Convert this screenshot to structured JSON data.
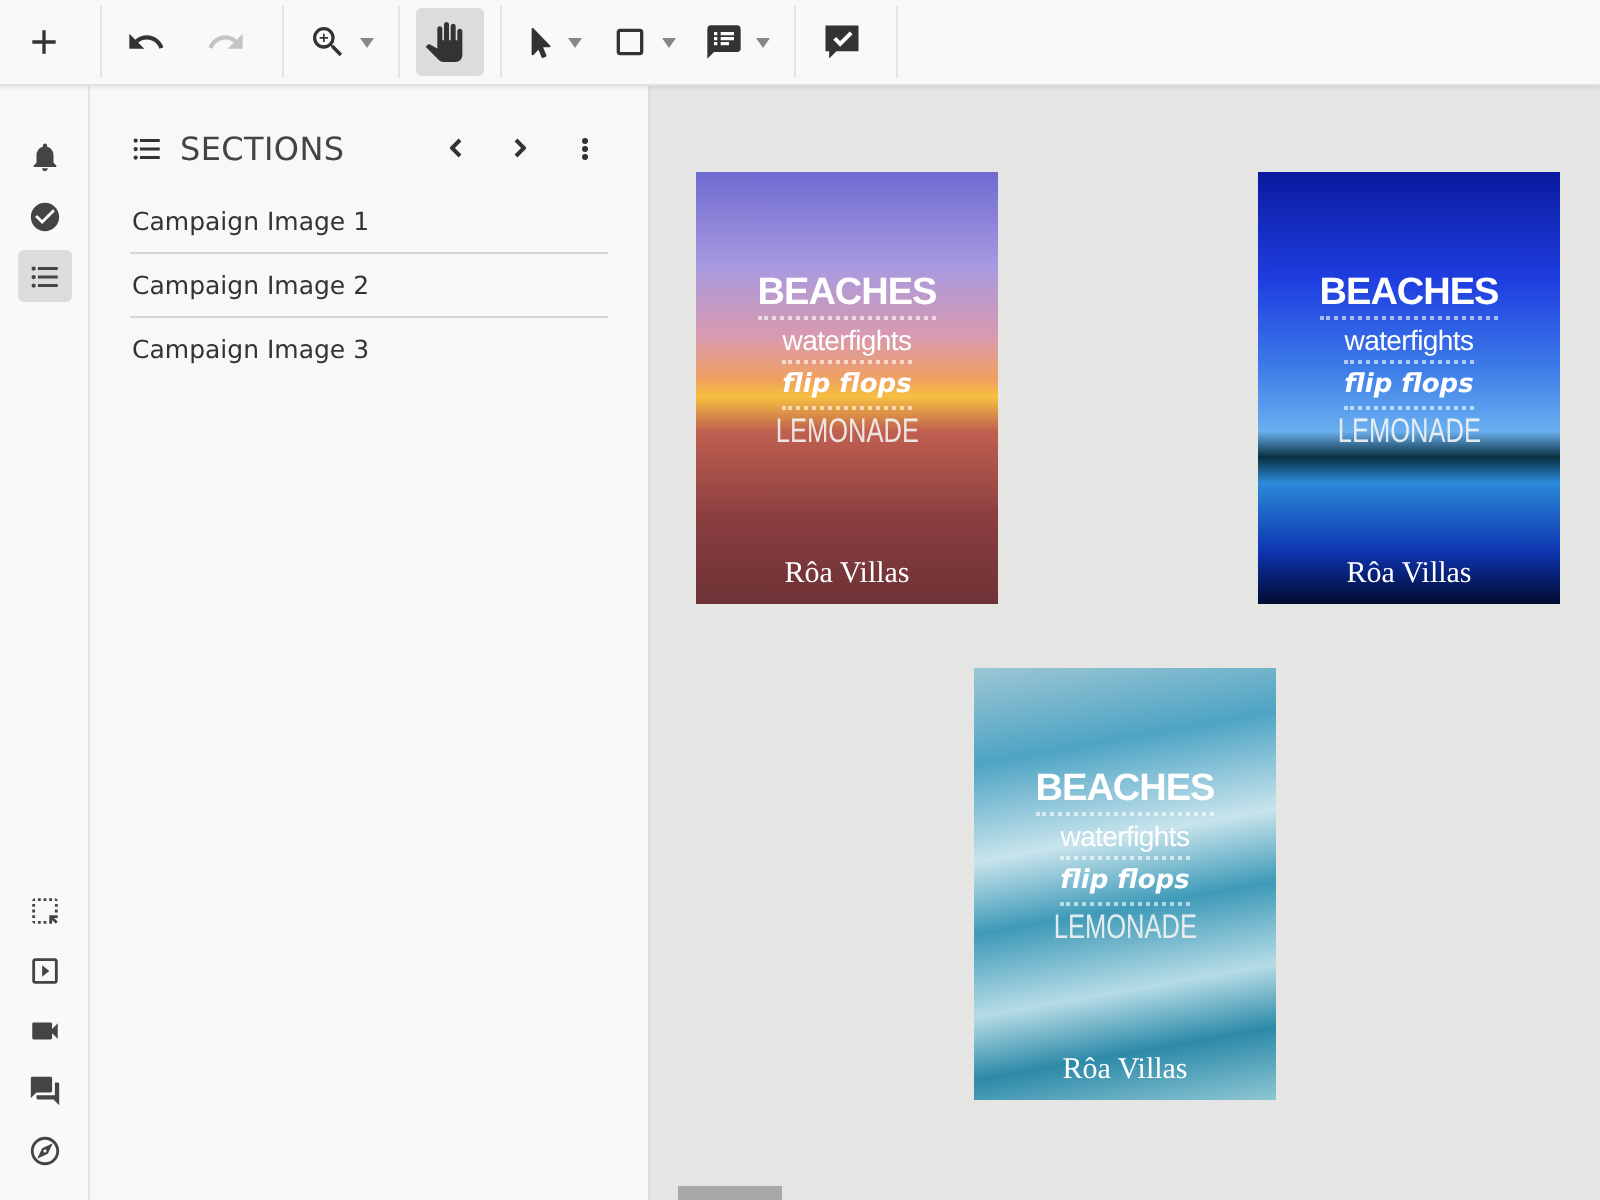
{
  "toolbar": {
    "groups": [
      [
        {
          "kind": "add",
          "selected": false,
          "disabled": false,
          "dropdown": false
        }
      ],
      [
        {
          "kind": "undo",
          "selected": false,
          "disabled": false,
          "dropdown": false
        },
        {
          "kind": "redo",
          "selected": false,
          "disabled": true,
          "dropdown": false
        }
      ],
      [
        {
          "kind": "zoom",
          "selected": false,
          "disabled": false,
          "dropdown": true
        }
      ],
      [
        {
          "kind": "hand",
          "selected": true,
          "disabled": false,
          "dropdown": false
        }
      ],
      [
        {
          "kind": "pointer",
          "selected": false,
          "disabled": false,
          "dropdown": true
        },
        {
          "kind": "rectangle",
          "selected": false,
          "disabled": false,
          "dropdown": true
        },
        {
          "kind": "note",
          "selected": false,
          "disabled": false,
          "dropdown": true
        }
      ],
      [
        {
          "kind": "approve",
          "selected": false,
          "disabled": false,
          "dropdown": false
        }
      ]
    ]
  },
  "rail": {
    "top": [
      {
        "kind": "notifications",
        "selected": false
      },
      {
        "kind": "tasks",
        "selected": false
      },
      {
        "kind": "sections",
        "selected": true
      }
    ],
    "bottom": [
      {
        "kind": "select",
        "selected": false
      },
      {
        "kind": "present",
        "selected": false
      },
      {
        "kind": "video",
        "selected": false
      },
      {
        "kind": "chat",
        "selected": false
      },
      {
        "kind": "explore",
        "selected": false
      }
    ]
  },
  "sections": {
    "title": "SECTIONS",
    "items": [
      {
        "label": "Campaign Image 1"
      },
      {
        "label": "Campaign Image 2"
      },
      {
        "label": "Campaign Image 3"
      }
    ]
  },
  "canvas": {
    "pages": [
      {
        "kind": "sunset",
        "headline": "BEACHES",
        "line_2": "waterfights",
        "line_3": "flip flops",
        "line_4": "LEMONADE",
        "brand": "Rôa Villas"
      },
      {
        "kind": "night",
        "headline": "BEACHES",
        "line_2": "waterfights",
        "line_3": "flip flops",
        "line_4": "LEMONADE",
        "brand": "Rôa Villas"
      },
      {
        "kind": "waves",
        "headline": "BEACHES",
        "line_2": "waterfights",
        "line_3": "flip flops",
        "line_4": "LEMONADE",
        "brand": "Rôa Villas"
      }
    ]
  }
}
